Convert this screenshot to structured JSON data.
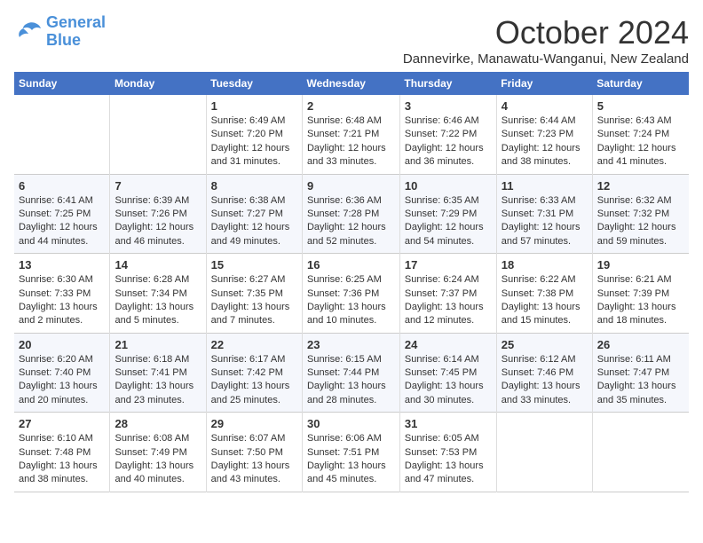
{
  "header": {
    "logo": {
      "line1": "General",
      "line2": "Blue"
    },
    "title": "October 2024",
    "subtitle": "Dannevirke, Manawatu-Wanganui, New Zealand"
  },
  "weekdays": [
    "Sunday",
    "Monday",
    "Tuesday",
    "Wednesday",
    "Thursday",
    "Friday",
    "Saturday"
  ],
  "weeks": [
    [
      {
        "day": "",
        "sunrise": "",
        "sunset": "",
        "daylight": ""
      },
      {
        "day": "",
        "sunrise": "",
        "sunset": "",
        "daylight": ""
      },
      {
        "day": "1",
        "sunrise": "Sunrise: 6:49 AM",
        "sunset": "Sunset: 7:20 PM",
        "daylight": "Daylight: 12 hours and 31 minutes."
      },
      {
        "day": "2",
        "sunrise": "Sunrise: 6:48 AM",
        "sunset": "Sunset: 7:21 PM",
        "daylight": "Daylight: 12 hours and 33 minutes."
      },
      {
        "day": "3",
        "sunrise": "Sunrise: 6:46 AM",
        "sunset": "Sunset: 7:22 PM",
        "daylight": "Daylight: 12 hours and 36 minutes."
      },
      {
        "day": "4",
        "sunrise": "Sunrise: 6:44 AM",
        "sunset": "Sunset: 7:23 PM",
        "daylight": "Daylight: 12 hours and 38 minutes."
      },
      {
        "day": "5",
        "sunrise": "Sunrise: 6:43 AM",
        "sunset": "Sunset: 7:24 PM",
        "daylight": "Daylight: 12 hours and 41 minutes."
      }
    ],
    [
      {
        "day": "6",
        "sunrise": "Sunrise: 6:41 AM",
        "sunset": "Sunset: 7:25 PM",
        "daylight": "Daylight: 12 hours and 44 minutes."
      },
      {
        "day": "7",
        "sunrise": "Sunrise: 6:39 AM",
        "sunset": "Sunset: 7:26 PM",
        "daylight": "Daylight: 12 hours and 46 minutes."
      },
      {
        "day": "8",
        "sunrise": "Sunrise: 6:38 AM",
        "sunset": "Sunset: 7:27 PM",
        "daylight": "Daylight: 12 hours and 49 minutes."
      },
      {
        "day": "9",
        "sunrise": "Sunrise: 6:36 AM",
        "sunset": "Sunset: 7:28 PM",
        "daylight": "Daylight: 12 hours and 52 minutes."
      },
      {
        "day": "10",
        "sunrise": "Sunrise: 6:35 AM",
        "sunset": "Sunset: 7:29 PM",
        "daylight": "Daylight: 12 hours and 54 minutes."
      },
      {
        "day": "11",
        "sunrise": "Sunrise: 6:33 AM",
        "sunset": "Sunset: 7:31 PM",
        "daylight": "Daylight: 12 hours and 57 minutes."
      },
      {
        "day": "12",
        "sunrise": "Sunrise: 6:32 AM",
        "sunset": "Sunset: 7:32 PM",
        "daylight": "Daylight: 12 hours and 59 minutes."
      }
    ],
    [
      {
        "day": "13",
        "sunrise": "Sunrise: 6:30 AM",
        "sunset": "Sunset: 7:33 PM",
        "daylight": "Daylight: 13 hours and 2 minutes."
      },
      {
        "day": "14",
        "sunrise": "Sunrise: 6:28 AM",
        "sunset": "Sunset: 7:34 PM",
        "daylight": "Daylight: 13 hours and 5 minutes."
      },
      {
        "day": "15",
        "sunrise": "Sunrise: 6:27 AM",
        "sunset": "Sunset: 7:35 PM",
        "daylight": "Daylight: 13 hours and 7 minutes."
      },
      {
        "day": "16",
        "sunrise": "Sunrise: 6:25 AM",
        "sunset": "Sunset: 7:36 PM",
        "daylight": "Daylight: 13 hours and 10 minutes."
      },
      {
        "day": "17",
        "sunrise": "Sunrise: 6:24 AM",
        "sunset": "Sunset: 7:37 PM",
        "daylight": "Daylight: 13 hours and 12 minutes."
      },
      {
        "day": "18",
        "sunrise": "Sunrise: 6:22 AM",
        "sunset": "Sunset: 7:38 PM",
        "daylight": "Daylight: 13 hours and 15 minutes."
      },
      {
        "day": "19",
        "sunrise": "Sunrise: 6:21 AM",
        "sunset": "Sunset: 7:39 PM",
        "daylight": "Daylight: 13 hours and 18 minutes."
      }
    ],
    [
      {
        "day": "20",
        "sunrise": "Sunrise: 6:20 AM",
        "sunset": "Sunset: 7:40 PM",
        "daylight": "Daylight: 13 hours and 20 minutes."
      },
      {
        "day": "21",
        "sunrise": "Sunrise: 6:18 AM",
        "sunset": "Sunset: 7:41 PM",
        "daylight": "Daylight: 13 hours and 23 minutes."
      },
      {
        "day": "22",
        "sunrise": "Sunrise: 6:17 AM",
        "sunset": "Sunset: 7:42 PM",
        "daylight": "Daylight: 13 hours and 25 minutes."
      },
      {
        "day": "23",
        "sunrise": "Sunrise: 6:15 AM",
        "sunset": "Sunset: 7:44 PM",
        "daylight": "Daylight: 13 hours and 28 minutes."
      },
      {
        "day": "24",
        "sunrise": "Sunrise: 6:14 AM",
        "sunset": "Sunset: 7:45 PM",
        "daylight": "Daylight: 13 hours and 30 minutes."
      },
      {
        "day": "25",
        "sunrise": "Sunrise: 6:12 AM",
        "sunset": "Sunset: 7:46 PM",
        "daylight": "Daylight: 13 hours and 33 minutes."
      },
      {
        "day": "26",
        "sunrise": "Sunrise: 6:11 AM",
        "sunset": "Sunset: 7:47 PM",
        "daylight": "Daylight: 13 hours and 35 minutes."
      }
    ],
    [
      {
        "day": "27",
        "sunrise": "Sunrise: 6:10 AM",
        "sunset": "Sunset: 7:48 PM",
        "daylight": "Daylight: 13 hours and 38 minutes."
      },
      {
        "day": "28",
        "sunrise": "Sunrise: 6:08 AM",
        "sunset": "Sunset: 7:49 PM",
        "daylight": "Daylight: 13 hours and 40 minutes."
      },
      {
        "day": "29",
        "sunrise": "Sunrise: 6:07 AM",
        "sunset": "Sunset: 7:50 PM",
        "daylight": "Daylight: 13 hours and 43 minutes."
      },
      {
        "day": "30",
        "sunrise": "Sunrise: 6:06 AM",
        "sunset": "Sunset: 7:51 PM",
        "daylight": "Daylight: 13 hours and 45 minutes."
      },
      {
        "day": "31",
        "sunrise": "Sunrise: 6:05 AM",
        "sunset": "Sunset: 7:53 PM",
        "daylight": "Daylight: 13 hours and 47 minutes."
      },
      {
        "day": "",
        "sunrise": "",
        "sunset": "",
        "daylight": ""
      },
      {
        "day": "",
        "sunrise": "",
        "sunset": "",
        "daylight": ""
      }
    ]
  ]
}
